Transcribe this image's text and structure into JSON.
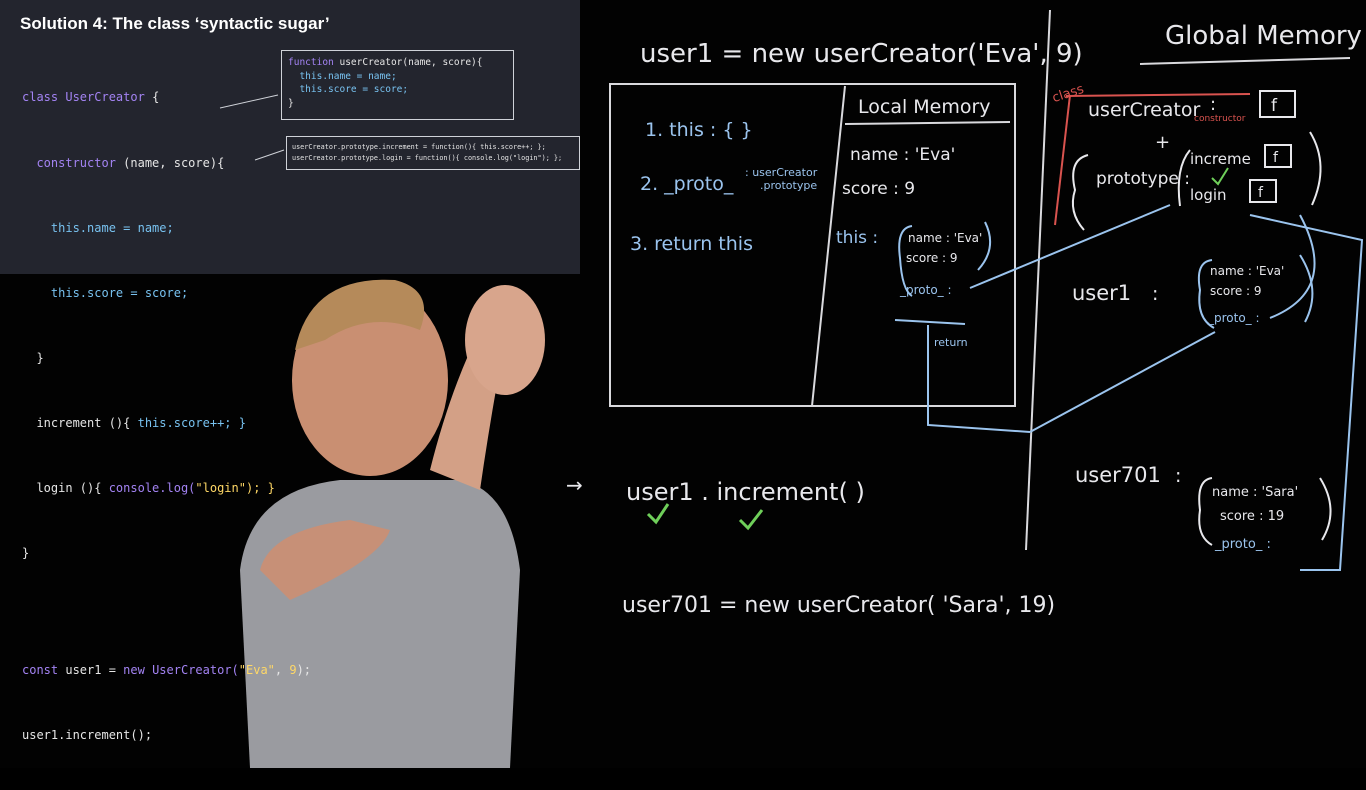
{
  "slide": {
    "title": "Solution 4: The class ‘syntactic sugar’",
    "code_lines": [
      {
        "a": "class ",
        "b": "UserCreator",
        "c": " {"
      },
      {
        "a": "  constructor ",
        "b": "(name, score){",
        "c": ""
      },
      {
        "a": "    this",
        "b": ".name = name;",
        "c": ""
      },
      {
        "a": "    this",
        "b": ".score = score;",
        "c": ""
      },
      {
        "a": "  }",
        "b": "",
        "c": ""
      },
      {
        "a": "  increment (){ ",
        "b": "this",
        "c": ".score++; }"
      },
      {
        "a": "  login (){ ",
        "b": "console.log(",
        "c": "\"login\"); }"
      },
      {
        "a": "}",
        "b": "",
        "c": ""
      }
    ],
    "const_line": {
      "kw": "const",
      "rest1": " user1 = ",
      "kw2": "new",
      "cls": " UserCreator(",
      "str": "\"Eva\"",
      "sep": ", ",
      "num": "9",
      "end": ");"
    },
    "call_line": "user1.increment();",
    "box_a": {
      "line1_kw": "function",
      "line1_name": " userCreator",
      "line1_rest": "(name, score){",
      "line2": "  this.name = name;",
      "line3": "  this.score = score;",
      "line4": "}"
    },
    "box_b": {
      "line1": "userCreator.prototype.increment = function(){ this.score++; };",
      "line2": "userCreator.prototype.login = function(){ console.log(\"login\"); };"
    }
  },
  "board": {
    "top_statement": "user1  =  new  userCreator('Eva', 9)",
    "exec_steps": [
      "1. this : {       }",
      "2. _proto_",
      "3. return  this"
    ],
    "proto_note_1": ": userCreator",
    "proto_note_2": ".prototype",
    "local_memory_title": "Local Memory",
    "local_name": "name   :  'Eva'",
    "local_score": "score   :     9",
    "local_this": "this :",
    "local_obj_name": "name : 'Eva'",
    "local_obj_score": "score : 9",
    "local_obj_proto": "_proto_ :",
    "return_label": "return",
    "global_memory_title": "Global Memory",
    "class_label": "class",
    "usercreator_label": "userCreator",
    "constructor_label": "constructor",
    "f_label": "f",
    "plus": "+",
    "prototype_label": "prototype :",
    "increment_label": "increme",
    "login_label": "login",
    "user1_label": "user1",
    "user1_name": "name : 'Eva'",
    "user1_score": "score : 9",
    "user1_proto": "_proto_ :",
    "increment_call": "user1 . increment( )",
    "arrow_mark": "→",
    "user701_label": "user701",
    "user701_name": "name : 'Sara'",
    "user701_score": "score : 19",
    "user701_proto": "_proto_ :",
    "user701_statement": "user701 = new  userCreator( 'Sara', 19)",
    "colon": ":"
  },
  "colors": {
    "slide_bg": "#23252e",
    "keyword": "#a383f3",
    "string": "#ffd866",
    "chalk": "#e8e8ec",
    "blue_chalk": "#9bc4ee",
    "red_chalk": "#d9534f",
    "green_check": "#6fcf5a"
  }
}
